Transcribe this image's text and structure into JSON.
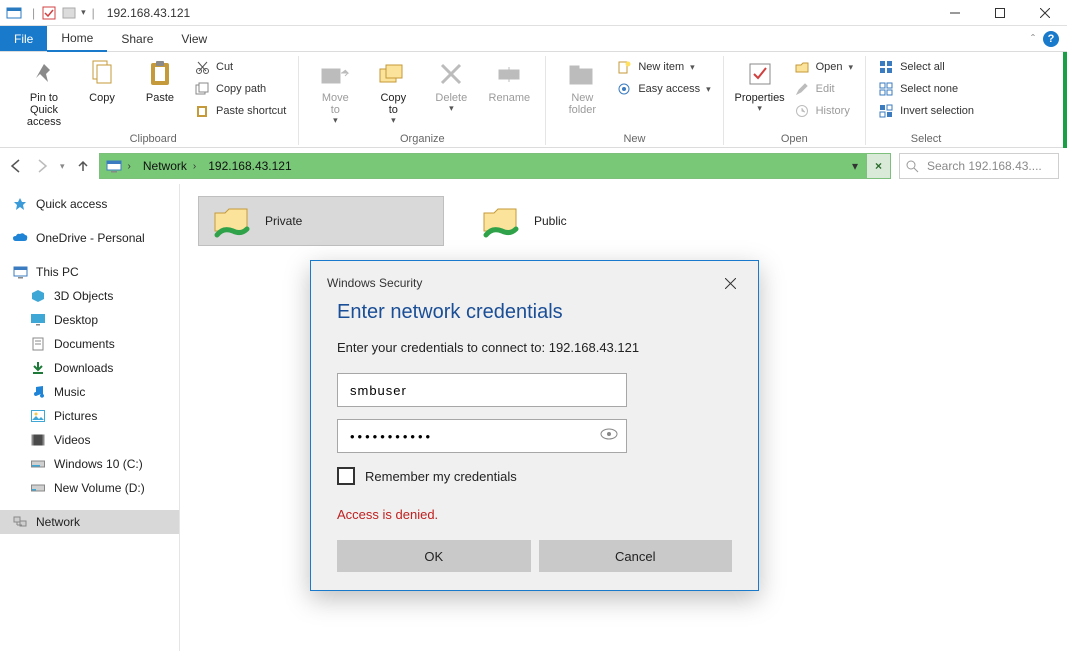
{
  "window": {
    "title": "192.168.43.121",
    "min": "—",
    "max": "▢",
    "close": "✕"
  },
  "ribbon_tabs": {
    "file": "File",
    "home": "Home",
    "share": "Share",
    "view": "View"
  },
  "ribbon": {
    "pin": "Pin to Quick\naccess",
    "copy": "Copy",
    "paste": "Paste",
    "cut": "Cut",
    "copy_path": "Copy path",
    "paste_shortcut": "Paste shortcut",
    "clipboard": "Clipboard",
    "move_to": "Move\nto",
    "copy_to": "Copy\nto",
    "delete": "Delete",
    "rename": "Rename",
    "organize": "Organize",
    "new_folder": "New\nfolder",
    "new_item": "New item",
    "easy_access": "Easy access",
    "new": "New",
    "properties": "Properties",
    "open_label": "Open",
    "edit": "Edit",
    "history": "History",
    "open_group": "Open",
    "select_all": "Select all",
    "select_none": "Select none",
    "invert_selection": "Invert selection",
    "select": "Select"
  },
  "address": {
    "segments": [
      "Network",
      "192.168.43.121"
    ],
    "refresh_glyph": "×"
  },
  "search": {
    "placeholder": "Search 192.168.43...."
  },
  "sidebar": {
    "quick_access": "Quick access",
    "onedrive": "OneDrive - Personal",
    "this_pc": "This PC",
    "items": [
      {
        "label": "3D Objects"
      },
      {
        "label": "Desktop"
      },
      {
        "label": "Documents"
      },
      {
        "label": "Downloads"
      },
      {
        "label": "Music"
      },
      {
        "label": "Pictures"
      },
      {
        "label": "Videos"
      },
      {
        "label": "Windows 10 (C:)"
      },
      {
        "label": "New Volume (D:)"
      }
    ],
    "network": "Network"
  },
  "content": {
    "folders": [
      {
        "name": "Private",
        "selected": true
      },
      {
        "name": "Public",
        "selected": false
      }
    ]
  },
  "dialog": {
    "title": "Windows Security",
    "heading": "Enter network credentials",
    "message": "Enter your credentials to connect to: 192.168.43.121",
    "username": "smbuser",
    "password": "•••••••••••",
    "remember": "Remember my credentials",
    "error": "Access is denied.",
    "ok": "OK",
    "cancel": "Cancel"
  }
}
